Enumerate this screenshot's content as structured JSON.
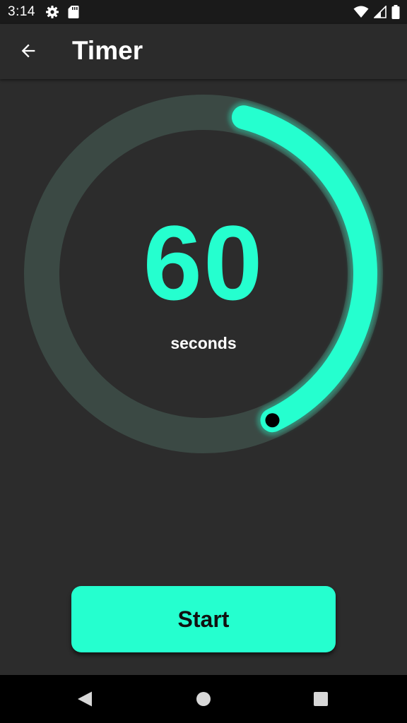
{
  "status_bar": {
    "time": "3:14",
    "icons": [
      "settings-icon",
      "sd-card-icon",
      "wifi-icon",
      "cell-signal-icon",
      "battery-icon"
    ]
  },
  "app_bar": {
    "title": "Timer",
    "back_icon": "arrow-back-icon"
  },
  "timer": {
    "value": "60",
    "unit": "seconds",
    "progress_fraction": 0.39
  },
  "actions": {
    "start_label": "Start"
  },
  "nav_bar": {
    "icons": [
      "back-triangle-icon",
      "home-circle-icon",
      "recents-square-icon"
    ]
  },
  "colors": {
    "accent": "#25ffcf",
    "background": "#2c2c2c",
    "app_bar": "#2b2b2b",
    "status_bar": "#1a1a1a",
    "track": "#3b4944"
  }
}
